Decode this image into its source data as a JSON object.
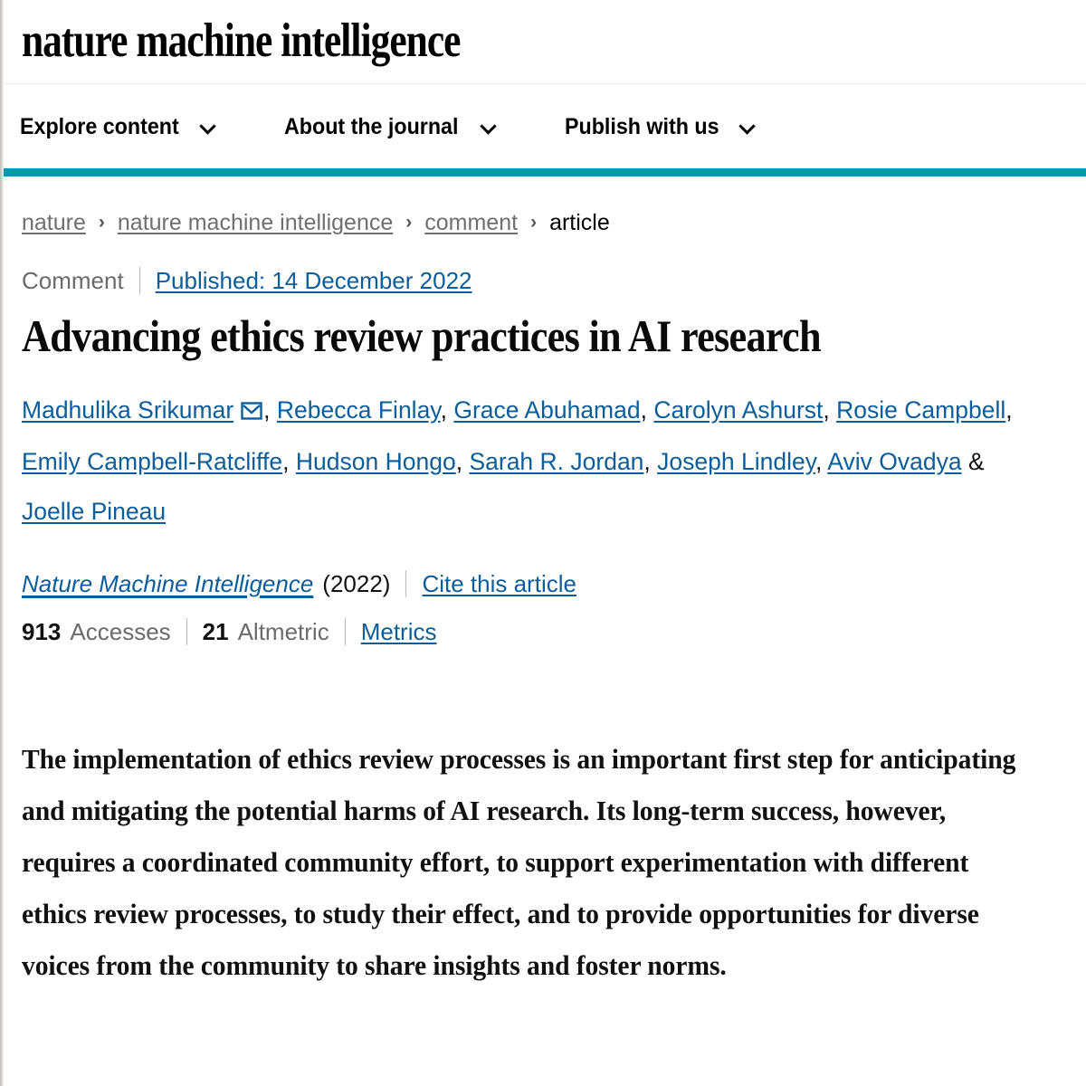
{
  "colors": {
    "accent_bar": "#0296b5",
    "link_blue": "#0b5d9b",
    "muted_gray": "#6b6b6b"
  },
  "masthead": {
    "title": "nature machine intelligence"
  },
  "nav": {
    "items": [
      {
        "label": "Explore content",
        "icon": "chevron-down-icon"
      },
      {
        "label": "About the journal",
        "icon": "chevron-down-icon"
      },
      {
        "label": "Publish with us",
        "icon": "chevron-down-icon"
      }
    ]
  },
  "breadcrumb": {
    "separator": "›",
    "items": [
      {
        "label": "nature",
        "current": false
      },
      {
        "label": "nature machine intelligence",
        "current": false
      },
      {
        "label": "comment",
        "current": false
      },
      {
        "label": "article",
        "current": true
      }
    ]
  },
  "kicker": {
    "type": "Comment",
    "published": "Published: 14 December 2022"
  },
  "article": {
    "title": "Advancing ethics review practices in AI research",
    "abstract": "The implementation of ethics review processes is an important first step for anticipating and mitigating the potential harms of AI research. Its long-term success, however, requires a coordinated community effort, to support experimentation with different ethics review processes, to study their effect, and to provide opportunities for diverse voices from the community to share insights and foster norms."
  },
  "authors": {
    "list": [
      {
        "name": "Madhulika Srikumar",
        "has_email_icon": true
      },
      {
        "name": "Rebecca Finlay",
        "has_email_icon": false
      },
      {
        "name": "Grace Abuhamad",
        "has_email_icon": false
      },
      {
        "name": "Carolyn Ashurst",
        "has_email_icon": false
      },
      {
        "name": "Rosie Campbell",
        "has_email_icon": false
      },
      {
        "name": "Emily Campbell-Ratcliffe",
        "has_email_icon": false
      },
      {
        "name": "Hudson Hongo",
        "has_email_icon": false
      },
      {
        "name": "Sarah R. Jordan",
        "has_email_icon": false
      },
      {
        "name": "Joseph Lindley",
        "has_email_icon": false
      },
      {
        "name": "Aviv Ovadya",
        "has_email_icon": false
      },
      {
        "name": "Joelle Pineau",
        "has_email_icon": false
      }
    ],
    "comma": ",",
    "ampersand": "&",
    "email_icon": "envelope-icon"
  },
  "citation": {
    "journal": "Nature Machine Intelligence",
    "year": "(2022)",
    "cite_label": "Cite this article"
  },
  "metrics": {
    "accesses_count": "913",
    "accesses_label": "Accesses",
    "altmetric_count": "21",
    "altmetric_label": "Altmetric",
    "metrics_label": "Metrics"
  }
}
